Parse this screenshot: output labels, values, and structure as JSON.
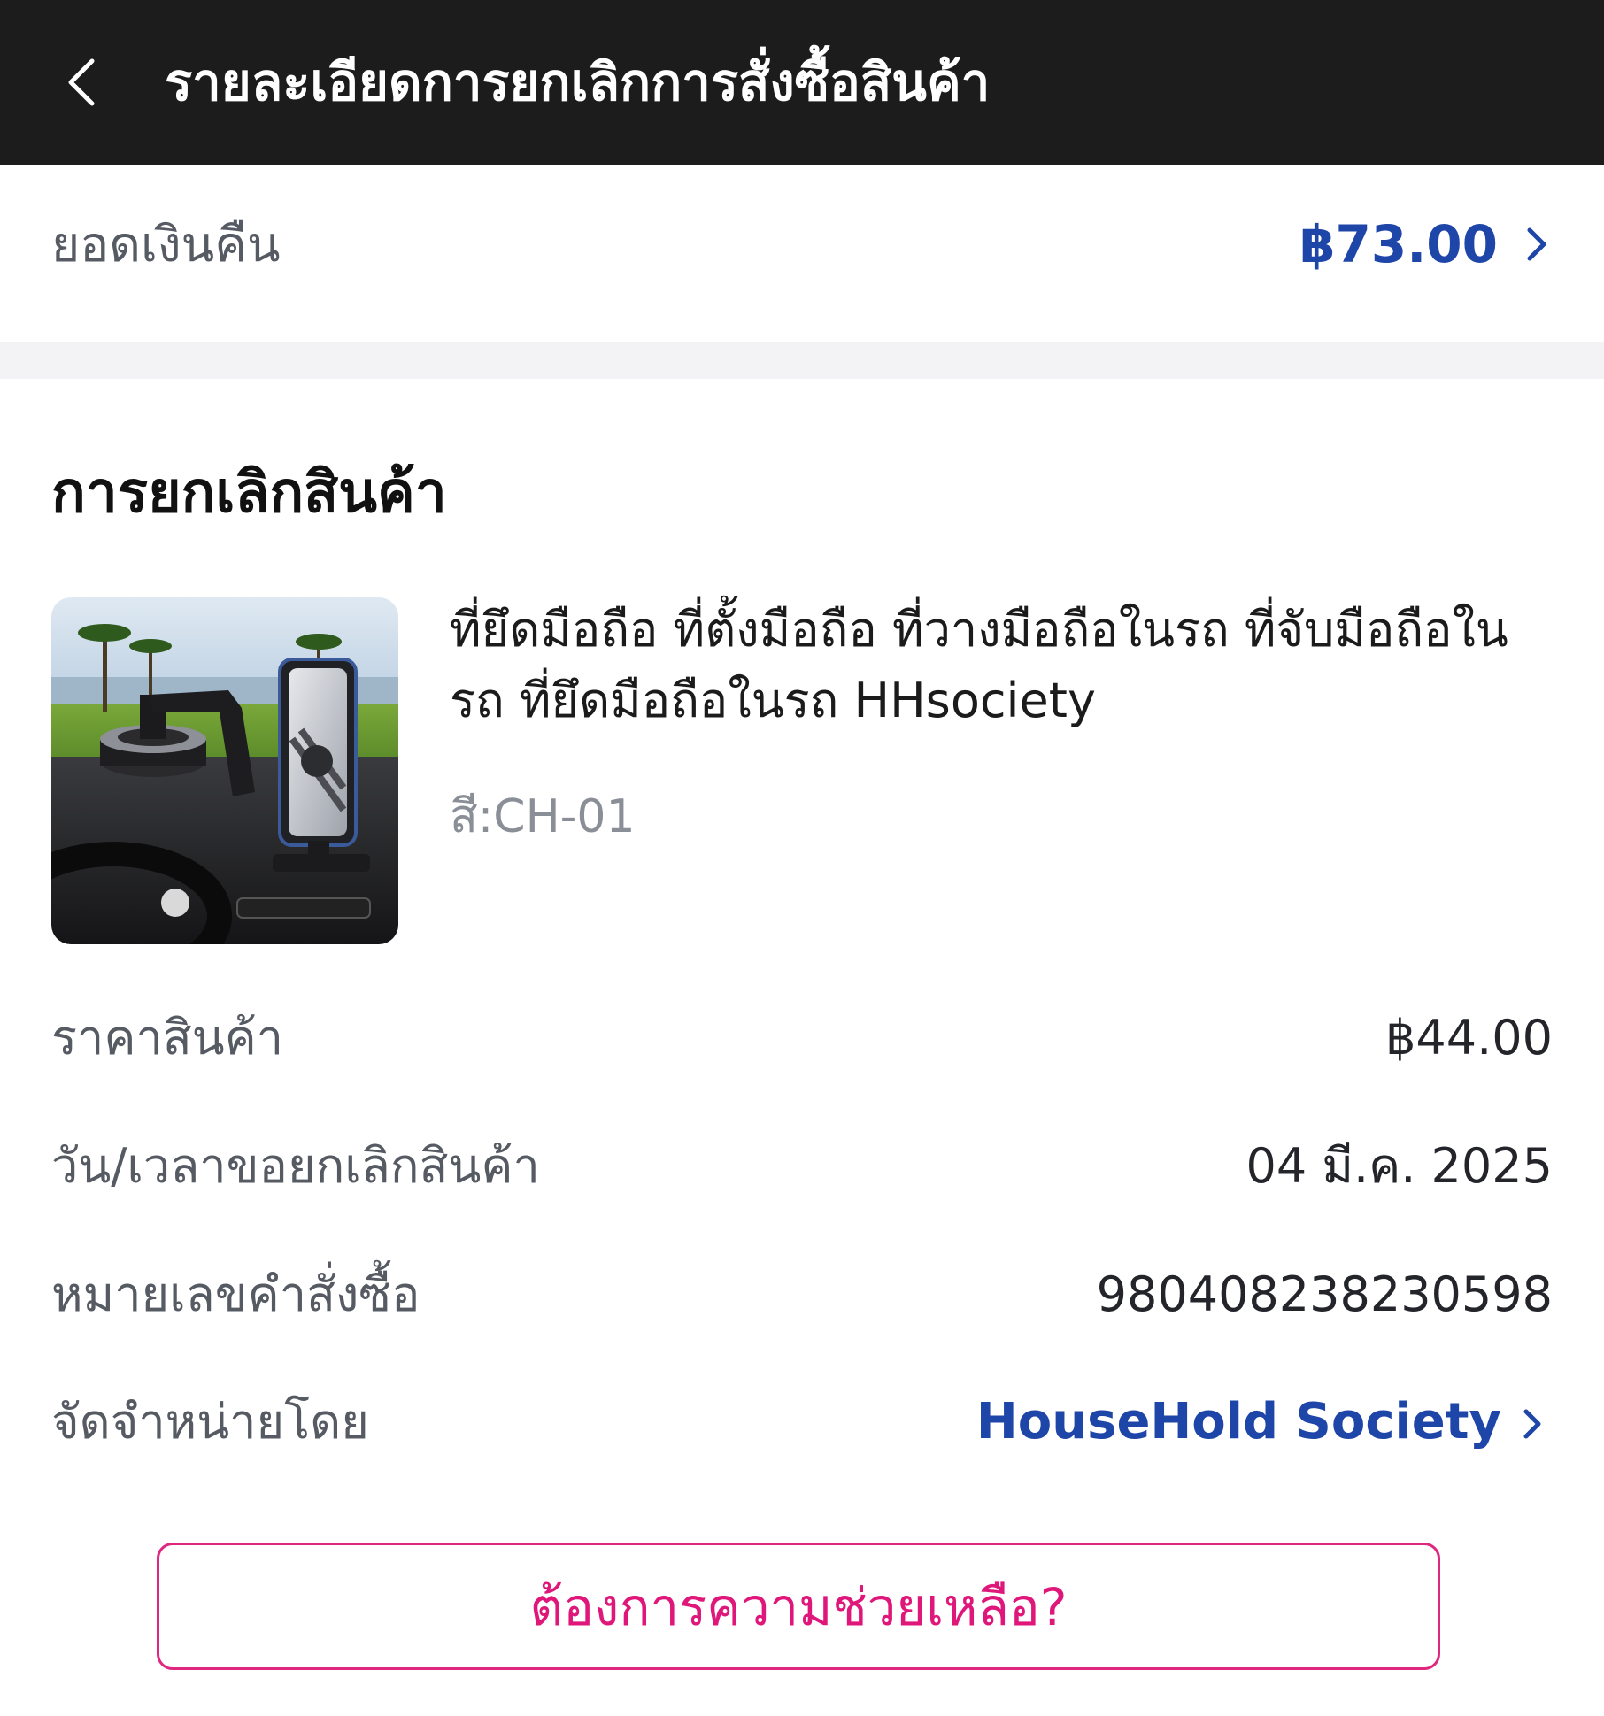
{
  "header": {
    "title": "รายละเอียดการยกเลิกการสั่งซื้อสินค้า",
    "back_icon": "chevron-left-icon"
  },
  "refund": {
    "label": "ยอดเงินคืน",
    "amount": "฿73.00",
    "chevron_icon": "chevron-right-icon"
  },
  "section": {
    "title": "การยกเลิกสินค้า"
  },
  "product": {
    "name": "ที่ยึดมือถือ ที่ตั้งมือถือ ที่วางมือถือในรถ ที่จับมือถือในรถ ที่ยึดมือถือในรถ HHsociety",
    "variant": "สี:CH-01",
    "image_icon": "car-phone-holder-image"
  },
  "details": {
    "price_label": "ราคาสินค้า",
    "price_value": "฿44.00",
    "date_label": "วัน/เวลาขอยกเลิกสินค้า",
    "date_value": "04 มี.ค. 2025",
    "order_label": "หมายเลขคำสั่งซื้อ",
    "order_value": "980408238230598",
    "seller_label": "จัดจำหน่ายโดย",
    "seller_value": "HouseHold Society"
  },
  "help": {
    "label": "ต้องการความช่วยเหลือ?"
  },
  "colors": {
    "header_bg": "#1c1c1c",
    "accent_blue": "#1e45a8",
    "help_pink": "#e0177a"
  }
}
